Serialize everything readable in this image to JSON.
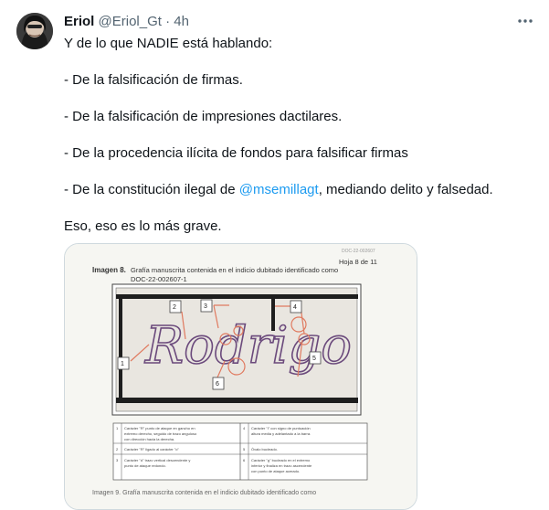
{
  "author": {
    "name": "Eriol",
    "handle": "@Eriol_Gt",
    "separator": "·",
    "time": "4h"
  },
  "icons": {
    "more": "more-horizontal-icon"
  },
  "colors": {
    "link": "#1d9bf0",
    "muted": "#536471",
    "text": "#0f1419"
  },
  "tweet": {
    "line1": "Y de lo que NADIE está hablando:",
    "line2": "- De la falsificación de firmas.",
    "line3": "- De la falsificación de impresiones dactilares.",
    "line4": "- De la procedencia ilícita de fondos para falsificar firmas",
    "line5_prefix": "- De la constitución ilegal de ",
    "line5_mention": "@msemillagt",
    "line5_suffix": ", mediando delito y falsedad.",
    "line6": "Eso, eso es lo más grave."
  },
  "document": {
    "doc_ref": "DOC-22-002607",
    "page": "Hoja 8 de 11",
    "caption_label": "Imagen 8.",
    "caption_text": "Grafía manuscrita contenida en el indicio dubitado identificado como",
    "caption_code": "DOC-22-002607-1",
    "signature": "Rodrigo",
    "markers": [
      "1",
      "2",
      "3",
      "4",
      "5",
      "6"
    ],
    "table": [
      {
        "num": "1",
        "text_a": "Carácter \"R\" punto de ataque en gancho en",
        "text_b": "extremo derecho, seguido de trazo anguloso",
        "text_c": "con dirección hacia la derecha."
      },
      {
        "num": "2",
        "text_a": "Carácter \"R\" ligado al carácter \"o\"",
        "text_b": "",
        "text_c": ""
      },
      {
        "num": "3",
        "text_a": "Carácter \"d\" trazo vertical descendente y",
        "text_b": "punto de ataque redondo.",
        "text_c": ""
      },
      {
        "num": "4",
        "text_a": "Carácter \"i\" con signo de puntuación",
        "text_b": "altura media y adelantado a la barra.",
        "text_c": ""
      },
      {
        "num": "5",
        "text_a": "Óvalo bucleado.",
        "text_b": "",
        "text_c": ""
      },
      {
        "num": "6",
        "text_a": "Carácter \"g\" bucleado en el extremo",
        "text_b": "inferior y finaliza en trazo ascendente",
        "text_c": "con punto de ataque acerado."
      }
    ],
    "next_caption": "Imagen 9. Grafía manuscrita contenida en el indicio dubitado identificado como"
  }
}
